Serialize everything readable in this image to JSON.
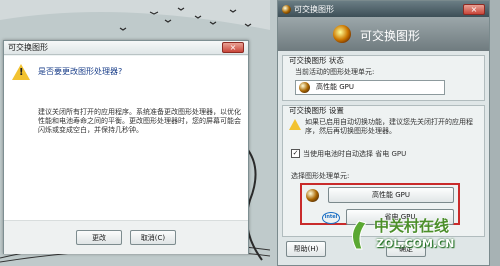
{
  "left_dialog": {
    "title": "可交换图形",
    "close_glyph": "×",
    "question": "是否要更改图形处理器?",
    "paragraph": "建议关闭所有打开的应用程序。系统准备更改图形处理器，以优化性能和电池寿命之间的平衡。更改图形处理器时，您的屏幕可能会闪烁或变成空白，并保持几秒钟。",
    "buttons": {
      "change": "更改",
      "cancel": "取消(C)"
    }
  },
  "right_window": {
    "title": "可交换图形",
    "close_glyph": "×",
    "header_title": "可交换图形",
    "status": {
      "label": "可交换图形 状态",
      "current_label": "当前活动的图形处理单元:",
      "current_value": "高性能 GPU"
    },
    "settings": {
      "label": "可交换图形 设置",
      "note": "如果已启用自动切换功能，建议您先关闭打开的应用程序，然后再切换图形处理器。",
      "auto_switch_label": "当使用电池时自动选择 省电 GPU",
      "auto_switch_checked": true,
      "select_label": "选择图形处理单元:",
      "high_perf_button": "高性能 GPU",
      "power_saving_button": "省电 GPU"
    },
    "footer": {
      "help": "帮助(H)",
      "ok": "确定"
    }
  },
  "watermark": {
    "line1": "中关村在线",
    "line2": "ZOL.COM.CN"
  },
  "colors": {
    "highlight_border": "#c92b2b",
    "warning": "#f2c230",
    "question_text": "#1b3f8a"
  }
}
